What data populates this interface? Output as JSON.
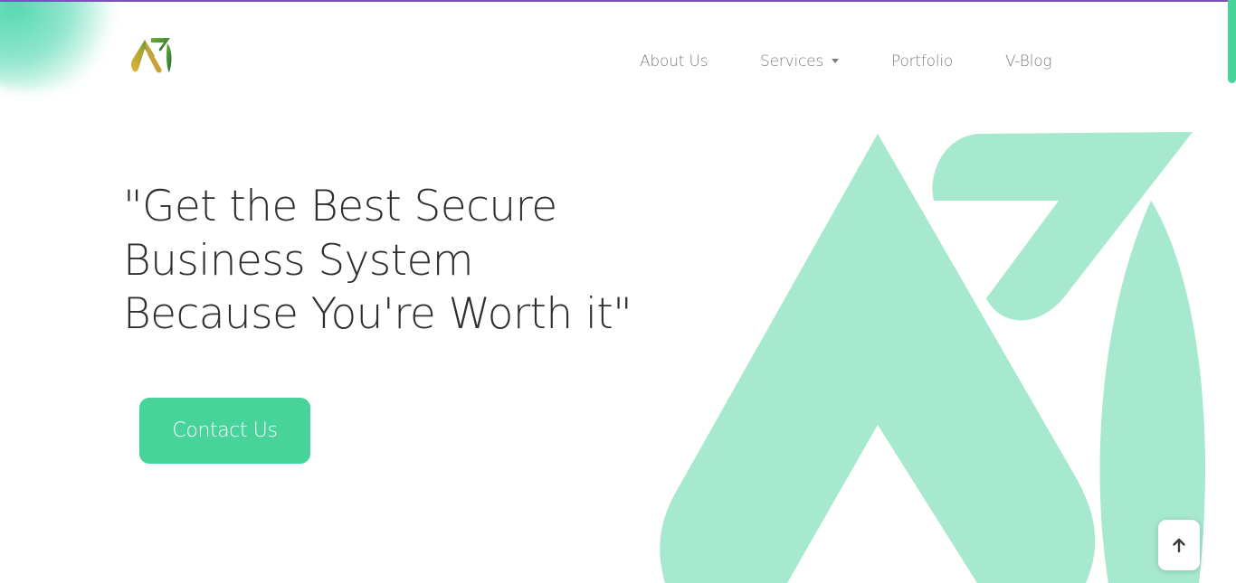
{
  "nav": {
    "items": [
      {
        "label": "About Us"
      },
      {
        "label": "Services",
        "has_dropdown": true
      },
      {
        "label": "Portfolio"
      },
      {
        "label": "V-Blog"
      }
    ]
  },
  "hero": {
    "headline_lines": [
      "\"Get the Best Secure",
      "Business System",
      "Because You're Worth it\""
    ],
    "cta_label": "Contact Us"
  },
  "icons": {
    "logo": "brand-logo",
    "back_to_top": "arrow-up-icon",
    "services_caret": "caret-down-icon"
  },
  "colors": {
    "accent": "#48d39b",
    "hero_mark": "#a6e9cf",
    "top_line": "#7b52b9",
    "text_dark": "#2f2f2f",
    "nav_text": "#7d7d7d"
  }
}
